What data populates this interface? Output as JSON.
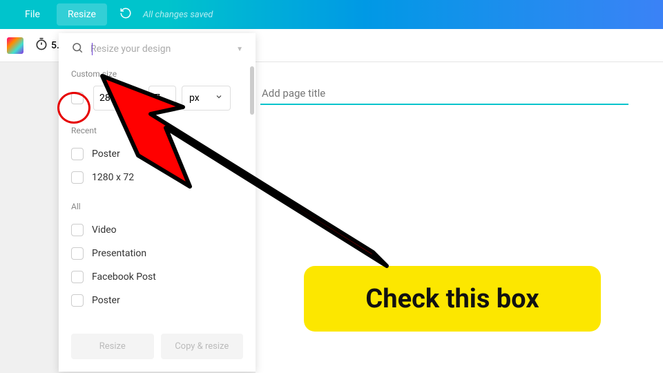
{
  "topbar": {
    "file": "File",
    "resize": "Resize",
    "saved": "All changes saved"
  },
  "secondary": {
    "timer": "5."
  },
  "panel": {
    "search_placeholder": "Resize your design",
    "custom_size_label": "Custom size",
    "width_value": "280",
    "height_value": "7",
    "unit": "px",
    "recent_label": "Recent",
    "recent_items": [
      "Poster",
      "1280 x 72"
    ],
    "all_label": "All",
    "all_items": [
      "Video",
      "Presentation",
      "Facebook Post",
      "Poster"
    ],
    "resize_btn": "Resize",
    "copy_resize_btn": "Copy & resize"
  },
  "canvas": {
    "page_title_placeholder": "Add page title"
  },
  "callout": {
    "text": "Check this box"
  }
}
